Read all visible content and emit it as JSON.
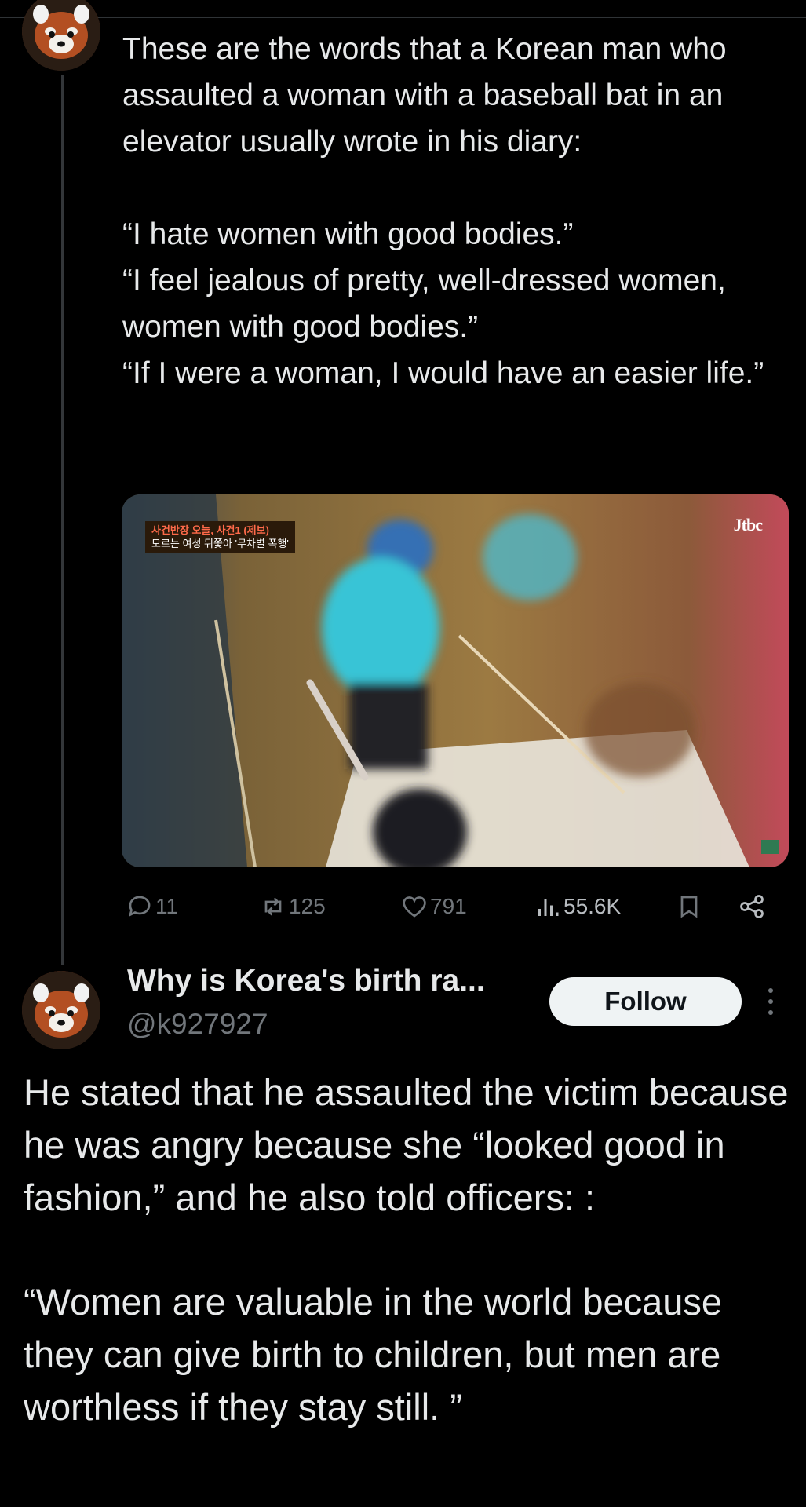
{
  "tweet1": {
    "intro": "These are the words that a Korean man who assaulted a woman with a baseball bat in an elevator usually wrote in his diary:",
    "quote1": "“I hate women with good bodies.”",
    "quote2": "“I feel jealous of pretty, well-dressed women, women with good bodies.”",
    "quote3": "“If I were a woman, I would have an easier life.”",
    "media": {
      "caption_line1": "사건반장 오늘, 사건1 (제보)",
      "caption_line2": "모르는 여성 뒤쫓아 '무차별 폭행'",
      "logo": "Jtbc"
    },
    "stats": {
      "replies": "11",
      "reposts": "125",
      "likes": "791",
      "views": "55.6K"
    }
  },
  "tweet2": {
    "author_name": "Why is Korea's birth ra...",
    "author_handle": "@k927927",
    "follow_label": "Follow",
    "paragraph1": "He stated that he assaulted the victim because he was angry because she “looked good in fashion,” and he also told officers: :",
    "paragraph2": "“Women are valuable in the world because they can give birth to children, but men are worthless if they stay still. ”"
  },
  "icons": {
    "reply": "reply-icon",
    "repost": "repost-icon",
    "like": "heart-icon",
    "views": "views-icon",
    "bookmark": "bookmark-icon",
    "share": "share-icon",
    "more": "more-vertical-icon"
  },
  "colors": {
    "background": "#000000",
    "text": "#e7e9ea",
    "secondary": "#71767b",
    "follow_bg": "#eff3f4"
  }
}
